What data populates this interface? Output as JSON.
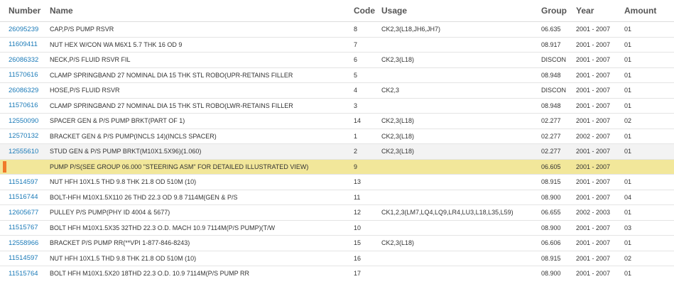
{
  "colors": {
    "link": "#1a7ab8",
    "highlight_row": "#f2e79a",
    "highlight_marker": "#f07a2a",
    "hover_row": "#f3f3f3"
  },
  "table": {
    "headers": {
      "number": "Number",
      "name": "Name",
      "code": "Code",
      "usage": "Usage",
      "group": "Group",
      "year": "Year",
      "amount": "Amount"
    },
    "rows": [
      {
        "number": "26095239",
        "name": "CAP,P/S PUMP RSVR",
        "code": "8",
        "usage": "CK2,3(L18,JH6,JH7)",
        "group": "06.635",
        "year": "2001 - 2007",
        "amount": "01",
        "state": "normal"
      },
      {
        "number": "11609411",
        "name": "NUT HEX W/CON WA M6X1 5.7 THK 16 OD 9",
        "code": "7",
        "usage": "",
        "group": "08.917",
        "year": "2001 - 2007",
        "amount": "01",
        "state": "normal"
      },
      {
        "number": "26086332",
        "name": "NECK,P/S FLUID RSVR FIL",
        "code": "6",
        "usage": "CK2,3(L18)",
        "group": "DISCON",
        "year": "2001 - 2007",
        "amount": "01",
        "state": "normal"
      },
      {
        "number": "11570616",
        "name": "CLAMP SPRINGBAND 27 NOMINAL DIA 15 THK STL ROBO(UPR-RETAINS FILLER",
        "code": "5",
        "usage": "",
        "group": "08.948",
        "year": "2001 - 2007",
        "amount": "01",
        "state": "normal"
      },
      {
        "number": "26086329",
        "name": "HOSE,P/S FLUID RSVR",
        "code": "4",
        "usage": "CK2,3",
        "group": "DISCON",
        "year": "2001 - 2007",
        "amount": "01",
        "state": "normal"
      },
      {
        "number": "11570616",
        "name": "CLAMP SPRINGBAND 27 NOMINAL DIA 15 THK STL ROBO(LWR-RETAINS FILLER",
        "code": "3",
        "usage": "",
        "group": "08.948",
        "year": "2001 - 2007",
        "amount": "01",
        "state": "normal"
      },
      {
        "number": "12550090",
        "name": "SPACER GEN & P/S PUMP BRKT(PART OF 1)",
        "code": "14",
        "usage": "CK2,3(L18)",
        "group": "02.277",
        "year": "2001 - 2007",
        "amount": "02",
        "state": "normal"
      },
      {
        "number": "12570132",
        "name": "BRACKET GEN & P/S PUMP(INCLS 14)(INCLS SPACER)",
        "code": "1",
        "usage": "CK2,3(L18)",
        "group": "02.277",
        "year": "2002 - 2007",
        "amount": "01",
        "state": "normal"
      },
      {
        "number": "12555610",
        "name": "STUD GEN & P/S PUMP BRKT(M10X1.5X96)(1.060)",
        "code": "2",
        "usage": "CK2,3(L18)",
        "group": "02.277",
        "year": "2001 - 2007",
        "amount": "01",
        "state": "hover"
      },
      {
        "number": "",
        "name": "PUMP P/S(SEE GROUP 06.000 \"STEERING ASM\" FOR DETAILED ILLUSTRATED VIEW)",
        "code": "9",
        "usage": "",
        "group": "06.605",
        "year": "2001 - 2007",
        "amount": "",
        "state": "highlight"
      },
      {
        "number": "11514597",
        "name": "NUT HFH 10X1.5 THD 9.8 THK 21.8 OD 510M (10)",
        "code": "13",
        "usage": "",
        "group": "08.915",
        "year": "2001 - 2007",
        "amount": "01",
        "state": "normal"
      },
      {
        "number": "11516744",
        "name": "BOLT-HFH M10X1.5X110 26 THD 22.3 OD 9.8 7114M(GEN & P/S",
        "code": "11",
        "usage": "",
        "group": "08.900",
        "year": "2001 - 2007",
        "amount": "04",
        "state": "normal"
      },
      {
        "number": "12605677",
        "name": "PULLEY P/S PUMP(PHY ID 4004 & 5677)",
        "code": "12",
        "usage": "CK1,2,3(LM7,LQ4,LQ9,LR4,LU3,L18,L35,L59)",
        "group": "06.655",
        "year": "2002 - 2003",
        "amount": "01",
        "state": "normal"
      },
      {
        "number": "11515767",
        "name": "BOLT HFH M10X1.5X35 32THD 22.3 O.D. MACH 10.9 7114M(P/S PUMP)(T/W",
        "code": "10",
        "usage": "",
        "group": "08.900",
        "year": "2001 - 2007",
        "amount": "03",
        "state": "normal"
      },
      {
        "number": "12558966",
        "name": "BRACKET P/S PUMP RR(**VPI 1-877-846-8243)",
        "code": "15",
        "usage": "CK2,3(L18)",
        "group": "06.606",
        "year": "2001 - 2007",
        "amount": "01",
        "state": "normal"
      },
      {
        "number": "11514597",
        "name": "NUT HFH 10X1.5 THD 9.8 THK 21.8 OD 510M (10)",
        "code": "16",
        "usage": "",
        "group": "08.915",
        "year": "2001 - 2007",
        "amount": "02",
        "state": "normal"
      },
      {
        "number": "11515764",
        "name": "BOLT HFH M10X1.5X20 18THD 22.3 O.D. 10.9 7114M(P/S PUMP RR",
        "code": "17",
        "usage": "",
        "group": "08.900",
        "year": "2001 - 2007",
        "amount": "01",
        "state": "normal"
      }
    ]
  }
}
